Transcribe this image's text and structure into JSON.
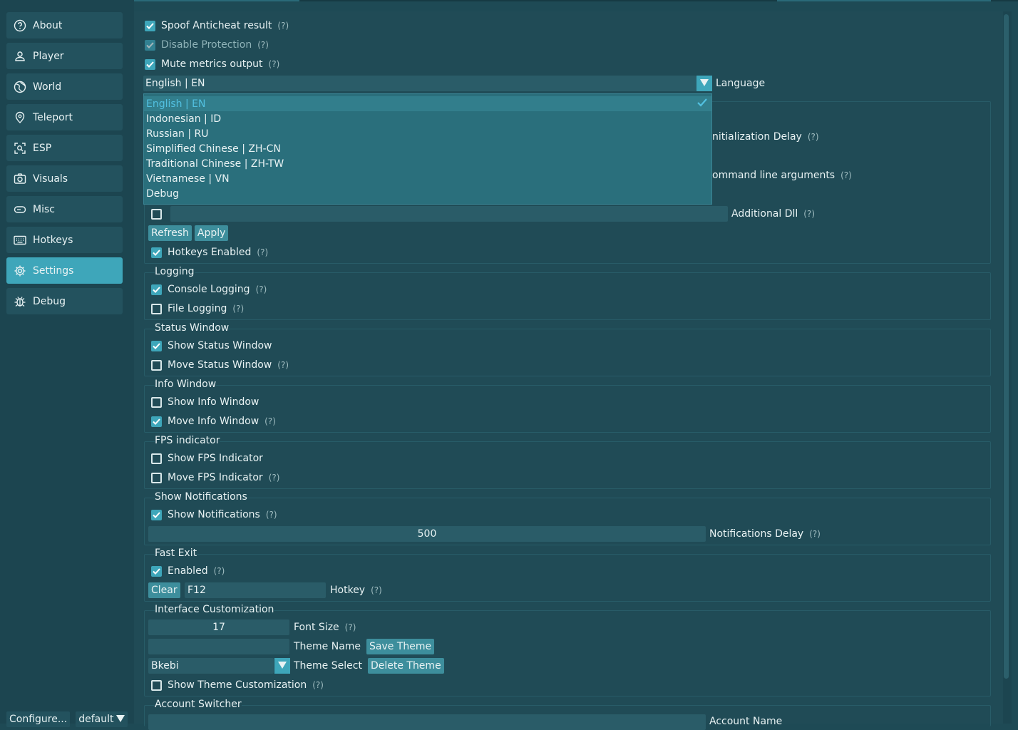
{
  "sidebar": {
    "items": [
      {
        "label": "About",
        "icon": "help-circle-icon",
        "active": false
      },
      {
        "label": "Player",
        "icon": "user-icon",
        "active": false
      },
      {
        "label": "World",
        "icon": "globe-icon",
        "active": false
      },
      {
        "label": "Teleport",
        "icon": "map-pin-icon",
        "active": false
      },
      {
        "label": "ESP",
        "icon": "scan-icon",
        "active": false
      },
      {
        "label": "Visuals",
        "icon": "camera-icon",
        "active": false
      },
      {
        "label": "Misc",
        "icon": "pill-icon",
        "active": false
      },
      {
        "label": "Hotkeys",
        "icon": "keyboard-icon",
        "active": false
      },
      {
        "label": "Settings",
        "icon": "gear-icon",
        "active": true
      },
      {
        "label": "Debug",
        "icon": "bug-icon",
        "active": false
      }
    ],
    "configure_label": "Configure...",
    "profile_label": "default"
  },
  "top": {
    "spoof": {
      "label": "Spoof Anticheat result",
      "help": "(?)",
      "checked": true
    },
    "disable_protection": {
      "label": "Disable Protection",
      "help": "(?)",
      "checked": true
    },
    "mute_metrics": {
      "label": "Mute metrics output",
      "help": "(?)",
      "checked": true
    }
  },
  "language": {
    "selected": "English | EN",
    "label": "Language",
    "options": [
      "English | EN",
      "Indonesian | ID",
      "Russian | RU",
      "Simplified Chinese | ZH-CN",
      "Traditional Chinese | ZH-TW",
      "Vietnamese | VN",
      "Debug"
    ]
  },
  "partial_labels": {
    "init_delay": "nitialization Delay",
    "cmd_args": "ommand line arguments",
    "help": "(?)"
  },
  "additional_dll": {
    "label": "Additional Dll",
    "help": "(?)",
    "value": "",
    "checked": false
  },
  "buttons": {
    "refresh": "Refresh",
    "apply": "Apply"
  },
  "hotkeys_enabled": {
    "label": "Hotkeys Enabled",
    "help": "(?)",
    "checked": true
  },
  "logging": {
    "title": "Logging",
    "console": {
      "label": "Console Logging",
      "help": "(?)",
      "checked": true
    },
    "file": {
      "label": "File Logging",
      "help": "(?)",
      "checked": false
    }
  },
  "status_window": {
    "title": "Status Window",
    "show": {
      "label": "Show Status Window",
      "checked": true
    },
    "move": {
      "label": "Move Status Window",
      "help": "(?)",
      "checked": false
    }
  },
  "info_window": {
    "title": "Info Window",
    "show": {
      "label": "Show Info Window",
      "checked": false
    },
    "move": {
      "label": "Move Info Window",
      "help": "(?)",
      "checked": true
    }
  },
  "fps": {
    "title": "FPS indicator",
    "show": {
      "label": "Show FPS Indicator",
      "checked": false
    },
    "move": {
      "label": "Move FPS Indicator",
      "help": "(?)",
      "checked": false
    }
  },
  "notifications": {
    "title": "Show Notifications",
    "show": {
      "label": "Show Notifications",
      "help": "(?)",
      "checked": true
    },
    "delay_value": "500",
    "delay_label": "Notifications Delay",
    "delay_help": "(?)"
  },
  "fast_exit": {
    "title": "Fast Exit",
    "enabled": {
      "label": "Enabled",
      "help": "(?)",
      "checked": true
    },
    "clear": "Clear",
    "hotkey_value": "F12",
    "hotkey_label": "Hotkey",
    "hotkey_help": "(?)"
  },
  "interface": {
    "title": "Interface Customization",
    "font_size_value": "17",
    "font_size_label": "Font Size",
    "font_size_help": "(?)",
    "theme_name_label": "Theme Name",
    "save_theme": "Save Theme",
    "theme_select_value": "Bkebi",
    "theme_select_label": "Theme Select",
    "delete_theme": "Delete Theme",
    "show_custom": {
      "label": "Show Theme Customization",
      "help": "(?)",
      "checked": false
    }
  },
  "account": {
    "title": "Account Switcher",
    "name_label": "Account Name"
  },
  "colors": {
    "accent": "#3ea6ba",
    "background": "#204b56",
    "sidebar": "#1c4550"
  }
}
